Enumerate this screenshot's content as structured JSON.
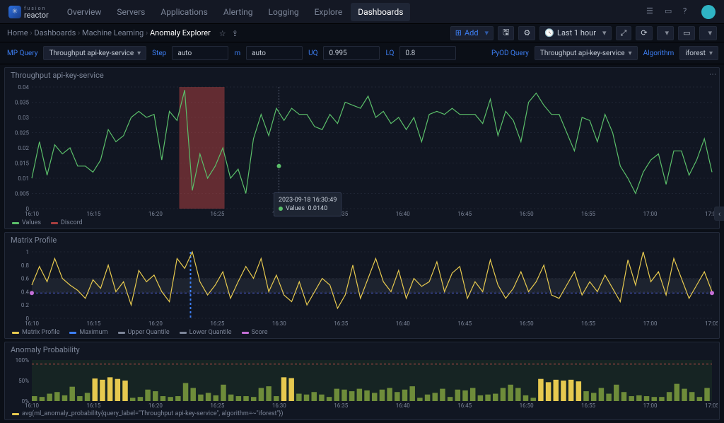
{
  "brand": {
    "top": "fusion",
    "bottom": "reactor"
  },
  "nav": [
    "Overview",
    "Servers",
    "Applications",
    "Alerting",
    "Logging",
    "Explore",
    "Dashboards"
  ],
  "nav_active": 6,
  "breadcrumbs": [
    "Home",
    "Dashboards",
    "Machine Learning",
    "Anomaly Explorer"
  ],
  "toolbar": {
    "add": "Add",
    "time_range": "Last 1 hour"
  },
  "query": {
    "mp_query_lbl": "MP Query",
    "mp_query_val": "Throughput api-key-service",
    "step_lbl": "Step",
    "step_val": "auto",
    "m_lbl": "m",
    "m_val": "auto",
    "uq_lbl": "UQ",
    "uq_val": "0.995",
    "lq_lbl": "LQ",
    "lq_val": "0.8",
    "pyod_lbl": "PyOD Query",
    "pyod_val": "Throughput api-key-service",
    "algo_lbl": "Algorithm",
    "algo_val": "iforest"
  },
  "panel1": {
    "title": "Throughput api-key-service",
    "tooltip_time": "2023-09-18 16:30:49",
    "tooltip_series": "Values",
    "tooltip_value": "0.0140",
    "legend": [
      {
        "name": "Values",
        "color": "#5bbf6a"
      },
      {
        "name": "Discord",
        "color": "#a83f3f"
      }
    ]
  },
  "panel2": {
    "title": "Matrix Profile",
    "legend": [
      {
        "name": "Matrix Profile",
        "color": "#e6c94f"
      },
      {
        "name": "Maximum",
        "color": "#3d7ff4"
      },
      {
        "name": "Upper Quantile",
        "color": "#7d8699"
      },
      {
        "name": "Lower Quantile",
        "color": "#7d8699"
      },
      {
        "name": "Score",
        "color": "#c46fd6"
      }
    ]
  },
  "panel3": {
    "title": "Anomaly Probability",
    "legend_text": "avg(ml_anomaly_probability{query_label=\"Throughput api-key-service\", algorithm=~\"iforest\"})"
  },
  "chart_data": [
    {
      "type": "line",
      "name": "Throughput api-key-service",
      "xlabel": "time",
      "ylabel": "",
      "ylim": [
        0,
        0.04
      ],
      "xticks": [
        "16:10",
        "16:15",
        "16:20",
        "16:25",
        "16:30",
        "16:35",
        "16:40",
        "16:45",
        "16:50",
        "16:55",
        "17:00",
        "17:05"
      ],
      "yticks": [
        0,
        0.005,
        0.01,
        0.015,
        0.02,
        0.025,
        0.03,
        0.035,
        0.04
      ],
      "series": [
        {
          "name": "Values",
          "color": "#5bbf6a",
          "values": [
            0.01,
            0.022,
            0.011,
            0.021,
            0.018,
            0.02,
            0.014,
            0.014,
            0.012,
            0.016,
            0.026,
            0.022,
            0.024,
            0.03,
            0.032,
            0.03,
            0.031,
            0.016,
            0.032,
            0.029,
            0.039,
            0.006,
            0.018,
            0.01,
            0.014,
            0.02,
            0.01,
            0.013,
            0.005,
            0.023,
            0.031,
            0.024,
            0.033,
            0.029,
            0.033,
            0.031,
            0.031,
            0.027,
            0.026,
            0.031,
            0.028,
            0.035,
            0.034,
            0.033,
            0.037,
            0.03,
            0.032,
            0.028,
            0.03,
            0.026,
            0.03,
            0.022,
            0.031,
            0.032,
            0.031,
            0.033,
            0.031,
            0.031,
            0.031,
            0.028,
            0.036,
            0.024,
            0.032,
            0.029,
            0.022,
            0.035,
            0.038,
            0.034,
            0.031,
            0.031,
            0.025,
            0.019,
            0.03,
            0.029,
            0.022,
            0.031,
            0.025,
            0.014,
            0.01,
            0.005,
            0.012,
            0.016,
            0.018,
            0.008,
            0.019,
            0.019,
            0.011,
            0.016,
            0.023,
            0.012
          ]
        }
      ],
      "annotations": [
        {
          "type": "discord_band",
          "x_from": "16:22",
          "x_to": "16:26"
        }
      ]
    },
    {
      "type": "line",
      "name": "Matrix Profile",
      "ylim": [
        0,
        1
      ],
      "xticks": [
        "16:10",
        "16:15",
        "16:20",
        "16:25",
        "16:30",
        "16:35",
        "16:40",
        "16:45",
        "16:50",
        "16:55",
        "17:00",
        "17:05"
      ],
      "yticks": [
        0,
        0.2,
        0.4,
        0.6,
        0.8,
        1.0
      ],
      "reference_lines": {
        "upper_quantile": 0.6,
        "lower_quantile": 0.38,
        "maximum_x": "16:23",
        "maximum_val": 1.0
      },
      "score_points": [
        {
          "x": "16:09",
          "y": 0.38
        },
        {
          "x": "17:09",
          "y": 0.38
        }
      ],
      "series": [
        {
          "name": "Matrix Profile",
          "color": "#e6c94f",
          "values": [
            0.5,
            0.78,
            0.55,
            0.9,
            0.6,
            0.5,
            0.42,
            0.3,
            0.58,
            0.45,
            0.8,
            0.4,
            0.55,
            0.2,
            0.72,
            0.55,
            0.65,
            0.4,
            0.25,
            0.9,
            0.75,
            1.0,
            0.55,
            0.35,
            0.5,
            0.7,
            0.3,
            0.55,
            0.78,
            0.6,
            0.9,
            0.4,
            0.65,
            0.35,
            0.25,
            0.55,
            0.2,
            0.4,
            0.6,
            0.5,
            0.15,
            0.35,
            0.8,
            0.3,
            0.6,
            0.9,
            0.55,
            0.4,
            0.72,
            0.3,
            0.6,
            0.48,
            0.55,
            0.85,
            0.4,
            0.68,
            0.78,
            0.3,
            0.55,
            0.4,
            0.88,
            0.5,
            0.3,
            0.45,
            0.7,
            0.4,
            0.55,
            0.8,
            0.35,
            0.3,
            0.5,
            0.7,
            0.35,
            0.55,
            0.4,
            0.65,
            0.45,
            0.25,
            0.88,
            0.5,
            1.0,
            0.55,
            0.7,
            0.35,
            0.9,
            0.6,
            0.3,
            0.5,
            0.7,
            0.4
          ]
        }
      ]
    },
    {
      "type": "bar",
      "name": "Anomaly Probability",
      "ylim": [
        0,
        100
      ],
      "yticks": [
        "0%",
        "50%",
        "100%"
      ],
      "xticks": [
        "16:10",
        "16:15",
        "16:20",
        "16:25",
        "16:30",
        "16:35",
        "16:40",
        "16:45",
        "16:50",
        "16:55",
        "17:00",
        "17:05"
      ],
      "threshold_line": 90,
      "series": [
        {
          "name": "avg(ml_anomaly_probability)",
          "color": "#e6c94f",
          "values": [
            12,
            10,
            18,
            22,
            14,
            35,
            12,
            20,
            55,
            52,
            58,
            54,
            50,
            8,
            10,
            28,
            24,
            12,
            10,
            12,
            44,
            32,
            16,
            20,
            14,
            40,
            16,
            12,
            12,
            10,
            32,
            36,
            12,
            58,
            56,
            18,
            16,
            22,
            16,
            10,
            30,
            28,
            24,
            30,
            26,
            20,
            28,
            32,
            22,
            28,
            36,
            8,
            16,
            20,
            30,
            10,
            28,
            26,
            32,
            14,
            16,
            18,
            32,
            40,
            32,
            14,
            8,
            54,
            46,
            52,
            50,
            52,
            48,
            24,
            20,
            32,
            18,
            40,
            22,
            12,
            14,
            12,
            10,
            10,
            22,
            42,
            30,
            22,
            10,
            32
          ]
        }
      ]
    }
  ]
}
